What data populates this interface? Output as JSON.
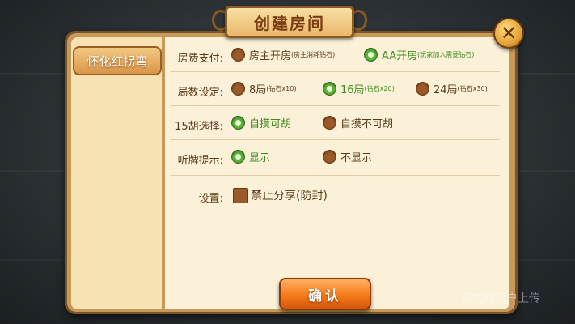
{
  "title": "创建房间",
  "sidebar_tab": "怀化红拐弯",
  "close_symbol": "✕",
  "rows": {
    "fee": {
      "label": "房费支付:",
      "options": [
        {
          "text": "房主开房",
          "note": "(房主消耗钻石)",
          "selected": false
        },
        {
          "text": "AA开房",
          "note": "(玩家加入需要钻石)",
          "selected": true
        }
      ]
    },
    "rounds": {
      "label": "局数设定:",
      "options": [
        {
          "text": "8局",
          "note": "(钻石x10)",
          "selected": false
        },
        {
          "text": "16局",
          "note": "(钻石x20)",
          "selected": true
        },
        {
          "text": "24局",
          "note": "(钻石x30)",
          "selected": false
        }
      ]
    },
    "hu15": {
      "label": "15胡选择:",
      "options": [
        {
          "text": "自摸可胡",
          "selected": true
        },
        {
          "text": "自摸不可胡",
          "selected": false
        }
      ]
    },
    "hint": {
      "label": "听牌提示:",
      "options": [
        {
          "text": "显示",
          "selected": true
        },
        {
          "text": "不显示",
          "selected": false
        }
      ]
    },
    "settings": {
      "label": "设置:",
      "checkbox": {
        "text": "禁止分享(防封)",
        "checked": false
      }
    }
  },
  "confirm_label": "确认",
  "watermark": "百姓网用户上传",
  "colors": {
    "selected": "#5fb33c",
    "unselected": "#9a5a2a",
    "panel": "#fbf1d9",
    "accent": "#f57a16"
  }
}
